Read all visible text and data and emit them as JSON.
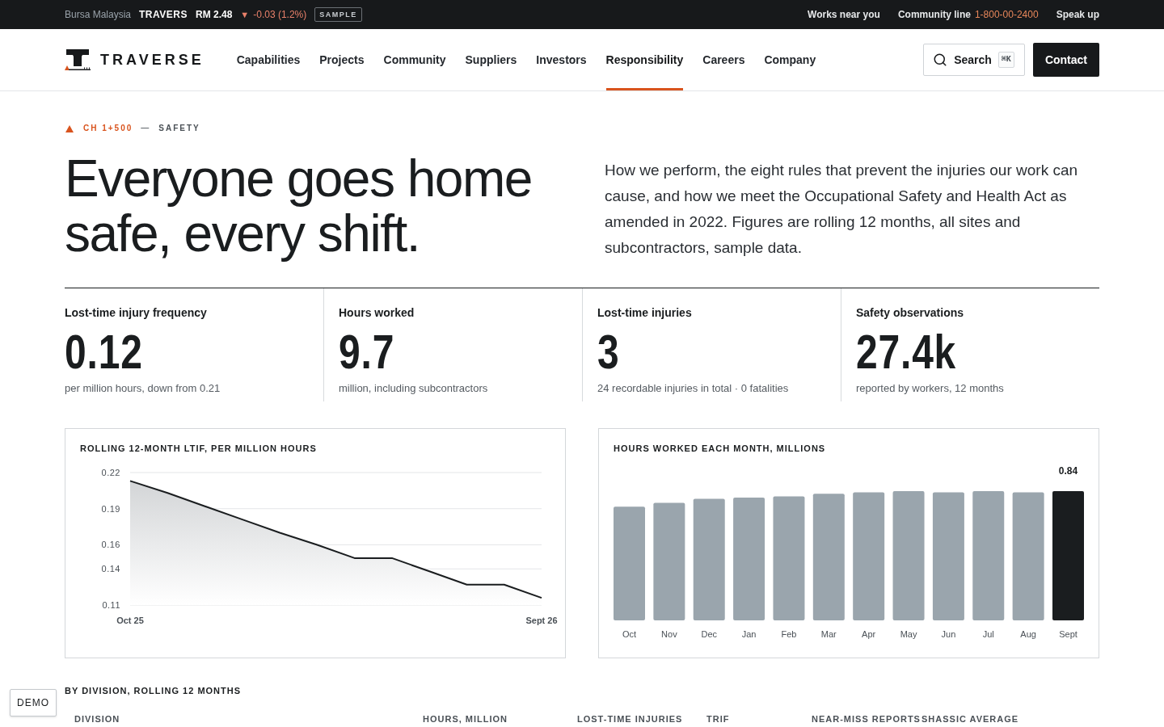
{
  "top_bar": {
    "exchange": "Bursa Malaysia",
    "ticker": "TRAVERS",
    "price": "RM 2.48",
    "arrow": "▼",
    "change": "-0.03 (1.2%)",
    "badge": "SAMPLE",
    "links": [
      {
        "label": "Works near you"
      },
      {
        "label": "Community line",
        "phone": "1-800-00-2400"
      },
      {
        "label": "Speak up"
      }
    ]
  },
  "header": {
    "brand": "TRAVERSE",
    "nav": [
      {
        "label": "Capabilities",
        "selected": false
      },
      {
        "label": "Projects",
        "selected": false
      },
      {
        "label": "Community",
        "selected": false
      },
      {
        "label": "Suppliers",
        "selected": false
      },
      {
        "label": "Investors",
        "selected": false
      },
      {
        "label": "Responsibility",
        "selected": true
      },
      {
        "label": "Careers",
        "selected": false
      },
      {
        "label": "Company",
        "selected": false
      }
    ],
    "search": {
      "label": "Search",
      "shortcut": "⌘K"
    },
    "contact_button": "Contact"
  },
  "hero": {
    "eyebrow": {
      "code": "CH 1+500",
      "separator": "—",
      "section": "SAFETY"
    },
    "title": "Everyone goes home safe, every shift.",
    "intro": "How we perform, the eight rules that prevent the injuries our work can cause, and how we meet the Occupational Safety and Health Act as amended in 2022. Figures are rolling 12 months, all sites and subcontractors, sample data."
  },
  "stats": [
    {
      "label": "Lost-time injury frequency",
      "value": "0.12",
      "note": "per million hours, down from 0.21"
    },
    {
      "label": "Hours worked",
      "value": "9.7",
      "note": "million, including subcontractors"
    },
    {
      "label": "Lost-time injuries",
      "value": "3",
      "note": "24 recordable injuries in total · 0 fatalities"
    },
    {
      "label": "Safety observations",
      "value": "27.4k",
      "note": "reported by workers, 12 months"
    }
  ],
  "ltif_chart": {
    "chart_data": {
      "type": "area",
      "title": "ROLLING 12-MONTH LTIF, PER MILLION HOURS",
      "categories": [
        "Oct 25",
        null,
        null,
        null,
        null,
        null,
        null,
        null,
        null,
        null,
        null,
        "Sept 26"
      ],
      "ylim": [
        0.11,
        0.22
      ],
      "yticks": [
        0.22,
        0.19,
        0.16,
        0.14,
        0.11
      ],
      "grid": true,
      "series": [
        {
          "color": "#1a1d1f",
          "values": [
            0.213,
            0.203,
            0.192,
            0.181,
            0.17,
            0.16,
            0.149,
            0.149,
            0.138,
            0.127,
            0.127,
            0.116
          ]
        }
      ]
    }
  },
  "hours_chart": {
    "title": "HOURS WORKED EACH MONTH, MILLIONS",
    "months": [
      {
        "label": "Oct",
        "highlighted": false
      },
      {
        "label": "Nov",
        "highlighted": false
      },
      {
        "label": "Dec",
        "highlighted": false
      },
      {
        "label": "Jan",
        "highlighted": false
      },
      {
        "label": "Feb",
        "highlighted": false
      },
      {
        "label": "Mar",
        "highlighted": false
      },
      {
        "label": "Apr",
        "highlighted": false
      },
      {
        "label": "May",
        "highlighted": false
      },
      {
        "label": "Jun",
        "highlighted": false
      },
      {
        "label": "Jul",
        "highlighted": false
      },
      {
        "label": "Aug",
        "highlighted": false
      },
      {
        "label": "Sept",
        "highlighted": true,
        "value_label": "0.84"
      }
    ]
  },
  "division_table": {
    "title": "BY DIVISION, ROLLING 12 MONTHS",
    "columns": [
      "DIVISION",
      "HOURS, MILLION",
      "LOST-TIME INJURIES",
      "TRIF",
      "NEAR-MISS REPORTS",
      "SHASSIC AVERAGE"
    ]
  },
  "demo_button": "DEMO"
}
